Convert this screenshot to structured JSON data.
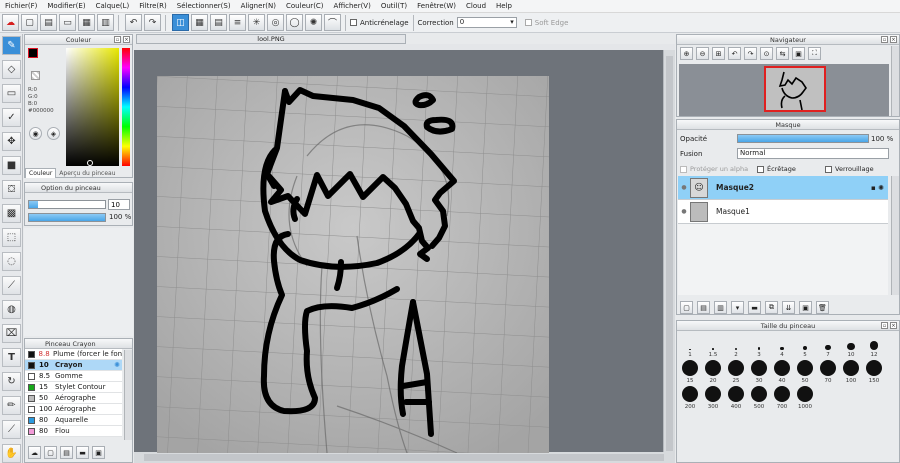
{
  "menu": [
    "Fichier(F)",
    "Modifier(E)",
    "Calque(L)",
    "Filtre(R)",
    "Sélectionner(S)",
    "Aligner(N)",
    "Couleur(C)",
    "Afficher(V)",
    "Outil(T)",
    "Fenêtre(W)",
    "Cloud",
    "Help"
  ],
  "toolbar": {
    "antialias_label": "Anticrénelage",
    "correction_label": "Correction",
    "correction_value": "0",
    "softedge_label": "Soft Edge"
  },
  "color_panel": {
    "title": "Couleur",
    "r": "R:0",
    "g": "G:0",
    "b": "B:0",
    "hex": "#000000",
    "tab_color": "Couleur",
    "tab_preview": "Aperçu du pinceau"
  },
  "brush_option": {
    "title": "Option du pinceau",
    "size_value": "10",
    "opacity_value": "100 %"
  },
  "brush_list": {
    "title": "Pinceau Crayon",
    "items": [
      {
        "size": "8.8",
        "name": "Plume (forcer le fond)",
        "color": "#111111",
        "size_color": "#d03030"
      },
      {
        "size": "10",
        "name": "Crayon",
        "color": "#111111",
        "size_color": "#111111"
      },
      {
        "size": "8.5",
        "name": "Gomme",
        "color": "#ffffff",
        "size_color": "#111111"
      },
      {
        "size": "15",
        "name": "Stylet Contour",
        "color": "#17a81a",
        "size_color": "#111111"
      },
      {
        "size": "50",
        "name": "Aérographe",
        "color": "#bdbdbd",
        "size_color": "#111111"
      },
      {
        "size": "100",
        "name": "Aérographe",
        "color": "#ffffff",
        "size_color": "#111111"
      },
      {
        "size": "80",
        "name": "Aquarelle",
        "color": "#2d9be0",
        "size_color": "#111111"
      },
      {
        "size": "80",
        "name": "Flou",
        "color": "#f29bd8",
        "size_color": "#111111"
      }
    ]
  },
  "document": {
    "tab_title": "lool.PNG"
  },
  "navigator": {
    "title": "Navigateur"
  },
  "layer_panel": {
    "title": "Masque",
    "opacity_label": "Opacité",
    "opacity_value": "100 %",
    "opacity_fraction": 1.0,
    "blend_label": "Fusion",
    "blend_value": "Normal",
    "protect_alpha": "Protéger un alpha",
    "clipping": "Écrêtage",
    "lock": "Verrouillage",
    "layers": [
      {
        "name": "Masque2",
        "selected": true
      },
      {
        "name": "Masque1",
        "selected": false
      }
    ]
  },
  "brush_size": {
    "title": "Taille du pinceau",
    "sizes": [
      "1",
      "1.5",
      "2",
      "3",
      "4",
      "5",
      "7",
      "10",
      "12",
      "15",
      "20",
      "25",
      "30",
      "40",
      "50",
      "70",
      "100",
      "150",
      "200",
      "300",
      "400",
      "500",
      "700",
      "1000"
    ]
  },
  "colors": {
    "accent": "#3a8fd8",
    "selection": "#8fd0f7"
  }
}
